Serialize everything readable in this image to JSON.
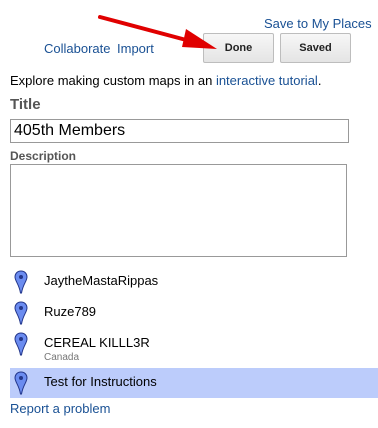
{
  "header": {
    "save_to_my_places": "Save to My Places",
    "collaborate": "Collaborate",
    "import": "Import",
    "done_label": "Done",
    "saved_label": "Saved"
  },
  "intro": {
    "prefix": "Explore making custom maps in an ",
    "link": "interactive tutorial",
    "suffix": "."
  },
  "form": {
    "title_label": "Title",
    "title_value": "405th Members",
    "description_label": "Description",
    "description_value": ""
  },
  "places": [
    {
      "name": "JaytheMastaRippas",
      "sub": "",
      "selected": false
    },
    {
      "name": "Ruze789",
      "sub": "",
      "selected": false
    },
    {
      "name": "CEREAL KILLL3R",
      "sub": "Canada",
      "selected": false
    },
    {
      "name": "Test for Instructions",
      "sub": "",
      "selected": true
    }
  ],
  "footer": {
    "report": "Report a problem"
  },
  "colors": {
    "link": "#1a5194",
    "selected_row": "#bcccfb",
    "pin": "#6b8cf0",
    "arrow": "#e00000"
  },
  "icons": {
    "placemark": "blue-placemark-pin-icon",
    "annotation": "red-arrow-icon"
  }
}
